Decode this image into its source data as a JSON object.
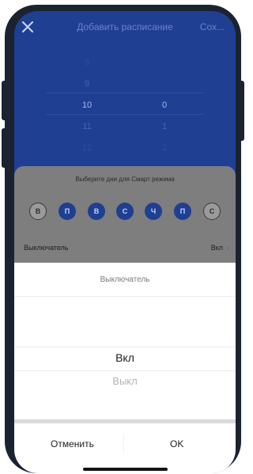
{
  "header": {
    "title": "Добавить расписание",
    "save_label": "Сох..."
  },
  "time_picker": {
    "hours": [
      "8",
      "9",
      "10",
      "11",
      "12"
    ],
    "minutes": [
      "",
      "",
      "0",
      "1",
      "2"
    ],
    "selected_hour": "10",
    "selected_minute": "0"
  },
  "smart_mode": {
    "label": "Выберите дни для Смарт режима",
    "days": [
      {
        "label": "В",
        "selected": false
      },
      {
        "label": "П",
        "selected": true
      },
      {
        "label": "В",
        "selected": true
      },
      {
        "label": "С",
        "selected": true
      },
      {
        "label": "Ч",
        "selected": true
      },
      {
        "label": "П",
        "selected": true
      },
      {
        "label": "С",
        "selected": false
      }
    ]
  },
  "switch_row": {
    "label": "Выключатель",
    "value": "Вкл",
    "chevron": "›"
  },
  "sheet": {
    "title": "Выключатель",
    "options": [
      "Вкл",
      "Выкл"
    ],
    "selected": "Вкл",
    "cancel_label": "Отменить",
    "ok_label": "OK"
  },
  "colors": {
    "primary": "#1f3f93",
    "frame": "#1b2230",
    "overlay": "#7e7e7e"
  }
}
